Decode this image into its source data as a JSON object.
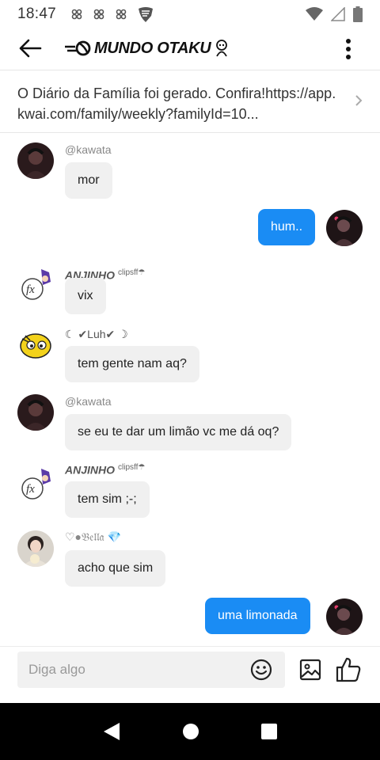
{
  "status_bar": {
    "time": "18:47",
    "notif_icons": [
      "app-notification-icon",
      "app-notification-icon",
      "app-notification-icon",
      "shield-icon"
    ],
    "right_icons": [
      "wifi-icon",
      "signal-icon",
      "battery-icon"
    ]
  },
  "header": {
    "title": "MUNDO OTAKU",
    "back_icon": "arrow-left-icon",
    "menu_icon": "more-vertical-icon"
  },
  "banner": {
    "text": "O Diário da Família foi gerado. Confira!https://app.kwai.com/family/weekly?familyId=10..."
  },
  "messages": [
    {
      "direction": "in",
      "sender": "@kawata",
      "sender_suffix": "",
      "text": "mor",
      "avatar": "avatar-kawata"
    },
    {
      "direction": "out",
      "sender": "",
      "sender_suffix": "",
      "text": "hum..",
      "avatar": "avatar-self"
    },
    {
      "direction": "in",
      "sender": "ANJINHO",
      "sender_suffix": "clipsff☂",
      "text": "vix",
      "avatar": "avatar-anjinho"
    },
    {
      "direction": "in",
      "sender": "☾ ✔Luh✔ ☽",
      "sender_suffix": "",
      "text": "tem gente nam aq?",
      "avatar": "avatar-luh"
    },
    {
      "direction": "in",
      "sender": "@kawata",
      "sender_suffix": "",
      "text": "se eu te dar um limão vc me dá oq?",
      "avatar": "avatar-kawata"
    },
    {
      "direction": "in",
      "sender": "ANJINHO",
      "sender_suffix": "clipsff☂",
      "text": "tem sim ;-;",
      "avatar": "avatar-anjinho"
    },
    {
      "direction": "in",
      "sender": "♡●𝔅𝔢𝔩𝔩𝔞 💎",
      "sender_suffix": "",
      "text": "acho que sim",
      "avatar": "avatar-bella"
    },
    {
      "direction": "out",
      "sender": "",
      "sender_suffix": "",
      "text": "uma limonada",
      "avatar": "avatar-self"
    }
  ],
  "input_bar": {
    "placeholder": "Diga algo",
    "emoji_icon": "emoji-icon",
    "image_icon": "image-icon",
    "like_icon": "thumbs-up-icon"
  },
  "nav_bar": {
    "icons": [
      "back-triangle-icon",
      "home-circle-icon",
      "recents-square-icon"
    ]
  },
  "colors": {
    "outgoing_bubble": "#1a8cf4",
    "incoming_bubble": "#f0f0f0",
    "nav_bar": "#000000"
  }
}
